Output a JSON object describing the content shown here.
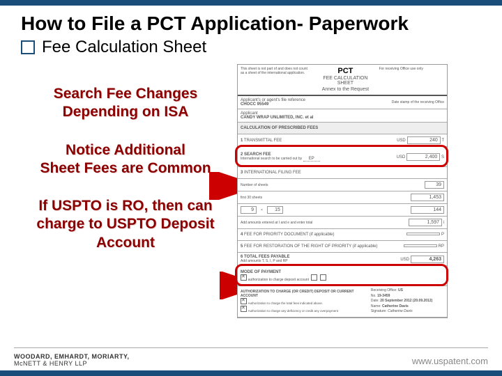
{
  "title": "How to File a PCT Application- Paperwork",
  "subtitle": "Fee Calculation Sheet",
  "emphasis1": "Search Fee Changes Depending on ISA",
  "emphasis2_line1": "Notice Additional",
  "emphasis2_line2": "Sheet Fees  are Common",
  "emphasis3": "If USPTO is RO, then can charge to USPTO Deposit Account",
  "form": {
    "pct": "PCT",
    "sheet_title": "FEE CALCULATION SHEET",
    "annex": "Annex to the Request",
    "file_ref": "CHOCC 95549",
    "applicant": "CANDY WRAP UNLIMITED, INC. et al",
    "calc_header": "CALCULATION OF PRESCRIBED FEES",
    "t_label": "T",
    "t_val": "240",
    "search_label": "SEARCH FEE",
    "s_val": "2,400",
    "isa_code": "EP",
    "intl_filing": "INTERNATIONAL FILING FEE",
    "sheets_val": "39",
    "row_a": "1,453",
    "row_b1": "9",
    "row_b2": "15",
    "row_b3": "144",
    "subtotal": "1,597",
    "priority_doc": "FEE FOR PRIORITY DOCUMENT (if applicable)",
    "restoration": "FEE FOR RESTORATION OF THE RIGHT OF PRIORITY (if applicable)",
    "total_label": "TOTAL FEES PAYABLE",
    "total_val": "4,263",
    "usd": "USD",
    "mode_payment": "MODE OF PAYMENT",
    "ro_country": "US",
    "acct_num": "19-3459",
    "date": "20 September 2012 (20.09.2012)",
    "name": "Catherine Davis"
  },
  "footer": {
    "logo_line1": "WOODARD, EMHARDT, MORIARTY,",
    "logo_line2": "McNETT & HENRY LLP",
    "url": "www.uspatent.com"
  }
}
